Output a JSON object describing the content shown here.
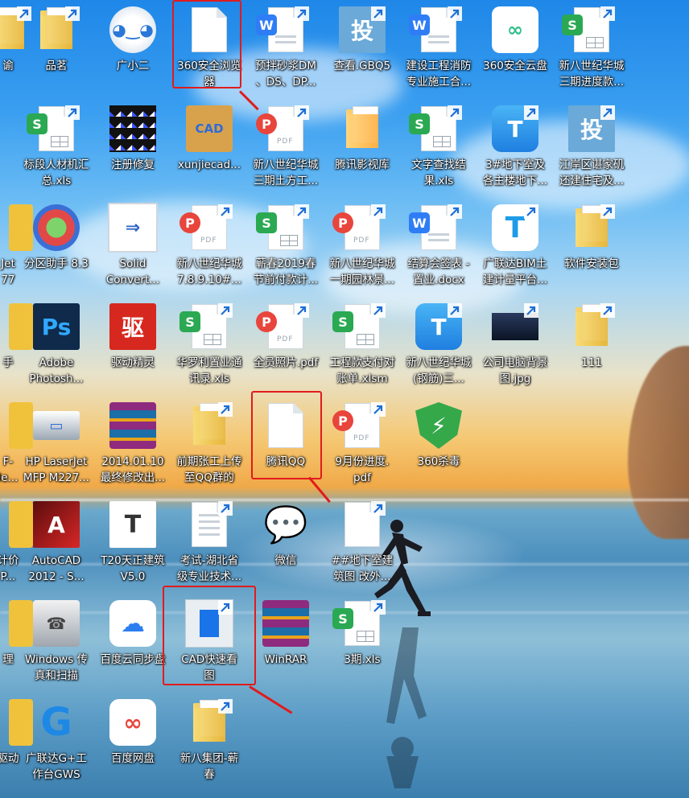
{
  "desktop": {
    "icons": [
      {
        "id": "c0r0",
        "label": "谕",
        "type": "folder"
      },
      {
        "id": "c1r0",
        "label": "品茗",
        "type": "folder"
      },
      {
        "id": "c2r0",
        "label": "广小二",
        "type": "robot"
      },
      {
        "id": "c3r0",
        "label": "360安全浏览\n器",
        "type": "blank"
      },
      {
        "id": "c4r0",
        "label": "预拌砂浆DM\n、DS、DP...",
        "type": "word"
      },
      {
        "id": "c5r0",
        "label": "查看.GBQ5",
        "type": "tou"
      },
      {
        "id": "c6r0",
        "label": "建设工程消防\n专业施工合...",
        "type": "word"
      },
      {
        "id": "c7r0",
        "label": "360安全云盘",
        "type": "cloud360"
      },
      {
        "id": "c8r0",
        "label": "新八世纪华城\n三期进度款...",
        "type": "sheet"
      },
      {
        "id": "c1r1",
        "label": "标段人材机汇\n总.xls",
        "type": "sheet"
      },
      {
        "id": "c2r1",
        "label": "注册修复",
        "type": "cubes"
      },
      {
        "id": "c3r1",
        "label": "xunjiecad...",
        "type": "cad"
      },
      {
        "id": "c4r1",
        "label": "新八世纪华城\n三期土方工...",
        "type": "pdf"
      },
      {
        "id": "c5r1",
        "label": "腾讯影视库",
        "type": "video"
      },
      {
        "id": "c6r1",
        "label": "文字查找结\n果.xls",
        "type": "sheet"
      },
      {
        "id": "c7r1",
        "label": "3#地下室及\n各主楼地下...",
        "type": "T"
      },
      {
        "id": "c8r1",
        "label": "江岸区谌家矶\n还建住宅及...",
        "type": "tou"
      },
      {
        "id": "c0r2",
        "label": "Jet\n77",
        "type": "partial"
      },
      {
        "id": "c1r2",
        "label": "分区助手 8.3",
        "type": "partition"
      },
      {
        "id": "c2r2",
        "label": "Solid\nConvert...",
        "type": "solid"
      },
      {
        "id": "c3r2",
        "label": "新八世纪华城\n7.8.9.10#...",
        "type": "pdf"
      },
      {
        "id": "c4r2",
        "label": "蕲春2019春\n节前付款计...",
        "type": "sheet"
      },
      {
        "id": "c5r2",
        "label": "新八世纪华城\n一期园林景...",
        "type": "pdf"
      },
      {
        "id": "c6r2",
        "label": "结算会签表 -\n置业.docx",
        "type": "word"
      },
      {
        "id": "c7r2",
        "label": "广联达BIM土\n建计量平台...",
        "type": "T2"
      },
      {
        "id": "c8r2",
        "label": "软件安装包",
        "type": "folder"
      },
      {
        "id": "c0r3",
        "label": "手",
        "type": "partial"
      },
      {
        "id": "c1r3",
        "label": "Adobe\nPhotosh...",
        "type": "ps"
      },
      {
        "id": "c2r3",
        "label": "驱动精灵",
        "type": "driver"
      },
      {
        "id": "c3r3",
        "label": "华罗利置业通\n讯录.xls",
        "type": "sheet"
      },
      {
        "id": "c4r3",
        "label": "全员照片.pdf",
        "type": "pdf"
      },
      {
        "id": "c5r3",
        "label": "工程款支付对\n账单.xlsm",
        "type": "sheet"
      },
      {
        "id": "c6r3",
        "label": "新八世纪华城\n(钢筋)三...",
        "type": "T"
      },
      {
        "id": "c7r3",
        "label": "公司电脑背景\n图.jpg",
        "type": "photo"
      },
      {
        "id": "c8r3",
        "label": "111",
        "type": "folder"
      },
      {
        "id": "c0r4",
        "label": "F-\nle...",
        "type": "partial"
      },
      {
        "id": "c1r4",
        "label": "HP LaserJet\nMFP M227...",
        "type": "scanner"
      },
      {
        "id": "c2r4",
        "label": "2014.01.10\n最终修改出...",
        "type": "rar"
      },
      {
        "id": "c3r4",
        "label": "前期张工上传\n至QQ群的",
        "type": "folder"
      },
      {
        "id": "c4r4",
        "label": "腾讯QQ",
        "type": "blank"
      },
      {
        "id": "c5r4",
        "label": "9月份进度.\npdf",
        "type": "pdf"
      },
      {
        "id": "c6r4",
        "label": "360杀毒",
        "type": "shield"
      },
      {
        "id": "c0r5",
        "label": "计价\nP...",
        "type": "partial"
      },
      {
        "id": "c1r5",
        "label": "AutoCAD\n2012 - S...",
        "type": "autocad"
      },
      {
        "id": "c2r5",
        "label": "T20天正建筑\nV5.0",
        "type": "tz"
      },
      {
        "id": "c3r5",
        "label": "考试-湖北省\n级专业技术...",
        "type": "txt"
      },
      {
        "id": "c4r5",
        "label": "微信",
        "type": "wechat"
      },
      {
        "id": "c5r5",
        "label": "##地下室建\n筑图 改外...",
        "type": "blankdoc"
      },
      {
        "id": "c0r6",
        "label": "理",
        "type": "partial"
      },
      {
        "id": "c1r6",
        "label": "Windows 传\n真和扫描",
        "type": "fax"
      },
      {
        "id": "c2r6",
        "label": "百度云同步盘",
        "type": "baiduyun"
      },
      {
        "id": "c3r6",
        "label": "CAD快速看\n图",
        "type": "cadview"
      },
      {
        "id": "c4r6",
        "label": "WinRAR",
        "type": "rar"
      },
      {
        "id": "c5r6",
        "label": "3期.xls",
        "type": "sheet"
      },
      {
        "id": "c0r7",
        "label": "驱动",
        "type": "partial"
      },
      {
        "id": "c1r7",
        "label": "广联达G+工\n作台GWS",
        "type": "gws"
      },
      {
        "id": "c2r7",
        "label": "百度网盘",
        "type": "baidupan"
      },
      {
        "id": "c3r7",
        "label": "新八集团-蕲\n春",
        "type": "folder"
      }
    ]
  },
  "colors": {
    "wps_green": "#2aa952",
    "wps_blue": "#2f7df6",
    "wps_red": "#e8453c",
    "annotation_red": "#e11b1b"
  }
}
